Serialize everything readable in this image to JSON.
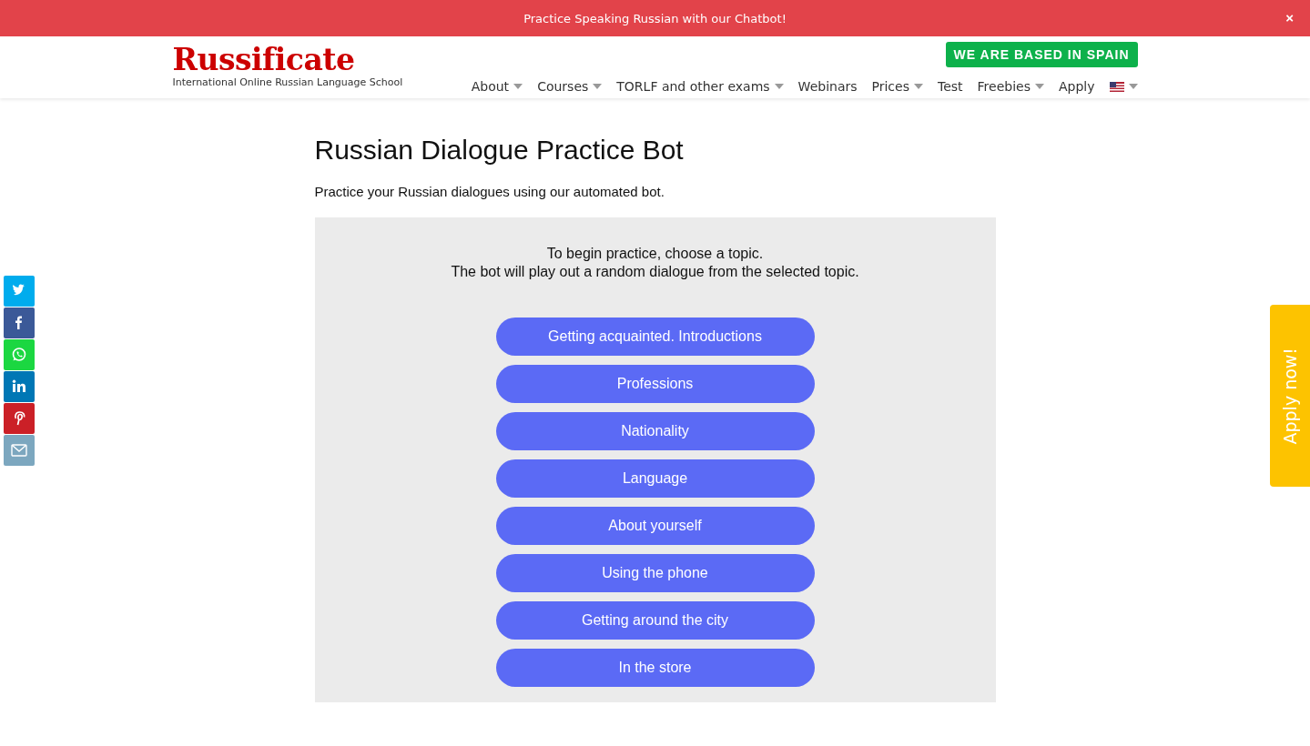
{
  "banner": {
    "text": "Practice Speaking Russian with our Chatbot!",
    "close": "×"
  },
  "header": {
    "logo": "Russificate",
    "tagline": "International Online Russian Language School",
    "badge": "WE ARE BASED IN SPAIN",
    "nav": [
      {
        "label": "About",
        "dropdown": true
      },
      {
        "label": "Courses",
        "dropdown": true
      },
      {
        "label": "TORLF and other exams",
        "dropdown": true
      },
      {
        "label": "Webinars",
        "dropdown": false
      },
      {
        "label": "Prices",
        "dropdown": true
      },
      {
        "label": "Test",
        "dropdown": false
      },
      {
        "label": "Freebies",
        "dropdown": true
      },
      {
        "label": "Apply",
        "dropdown": false
      }
    ]
  },
  "page": {
    "title": "Russian Dialogue Practice Bot",
    "intro": "Practice your Russian dialogues using our automated bot.",
    "instructions": [
      "To begin practice, choose a topic.",
      "The bot will play out a random dialogue from the selected topic."
    ],
    "topics": [
      "Getting acquainted. Introductions",
      "Professions",
      "Nationality",
      "Language",
      "About yourself",
      "Using the phone",
      "Getting around the city",
      "In the store"
    ]
  },
  "share": [
    {
      "kind": "twitter",
      "color": "#00aced"
    },
    {
      "kind": "facebook",
      "color": "#3b5998"
    },
    {
      "kind": "whatsapp",
      "color": "#1bd741"
    },
    {
      "kind": "linkedin",
      "color": "#0077b5"
    },
    {
      "kind": "pinterest",
      "color": "#cb2027"
    },
    {
      "kind": "email",
      "color": "#7ca7bf"
    }
  ],
  "side_tab": {
    "label": "Apply now!"
  }
}
